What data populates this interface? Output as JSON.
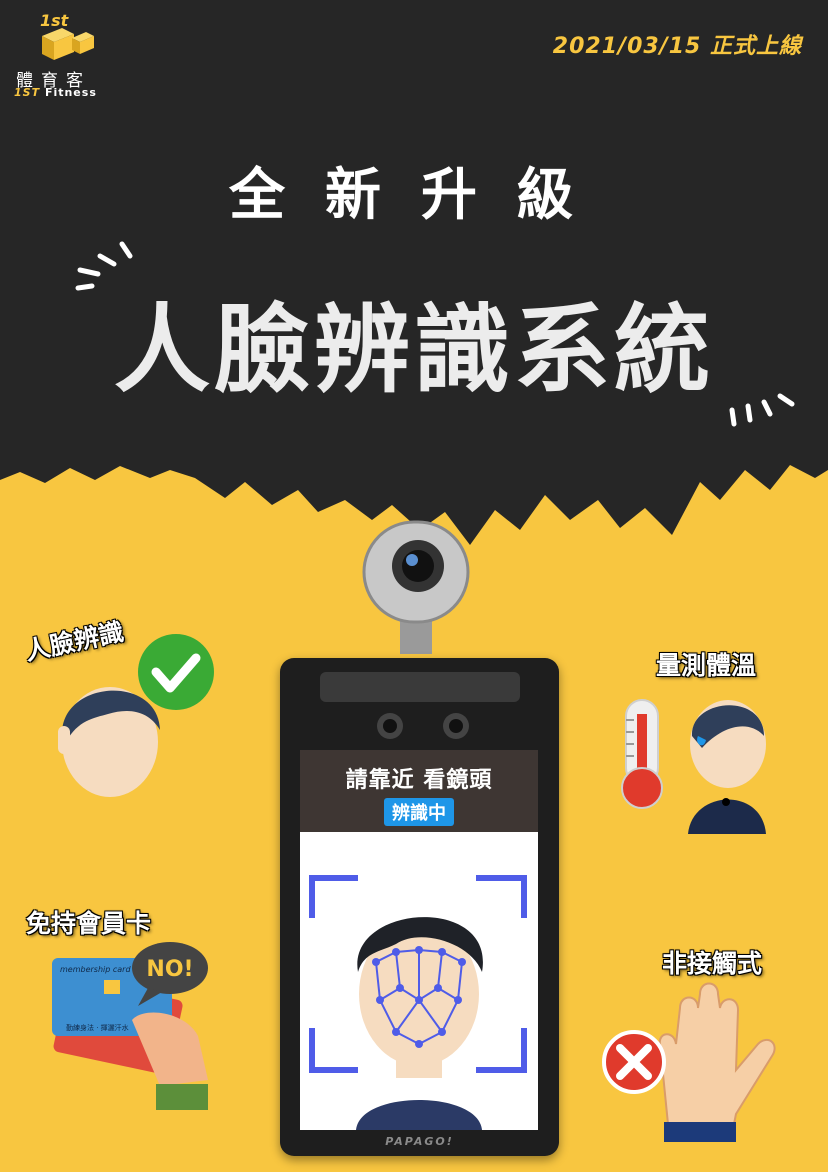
{
  "logo": {
    "badge_text": "1st",
    "name_cn": "體育客",
    "name_en_prefix": "1ST",
    "name_en_suffix": "Fitness"
  },
  "date_text": "2021/03/15 正式上線",
  "subtitle": "全新升級",
  "title": "人臉辨識系統",
  "features": {
    "face_id": "人臉辨識",
    "temperature": "量測體溫",
    "no_card": "免持會員卡",
    "touchless": "非接觸式"
  },
  "device": {
    "prompt": "請靠近 看鏡頭",
    "status": "辨識中",
    "brand": "PAPAGO!"
  },
  "card": {
    "header": "membership card 會員卡",
    "footer": "勤練身法 · 揮灑汗水",
    "bubble": "NO!"
  },
  "colors": {
    "background_dark": "#262626",
    "background_yellow": "#f8c640",
    "accent_blue": "#1e96e8",
    "check_green": "#3aaa35",
    "cross_red": "#e03a2c"
  }
}
